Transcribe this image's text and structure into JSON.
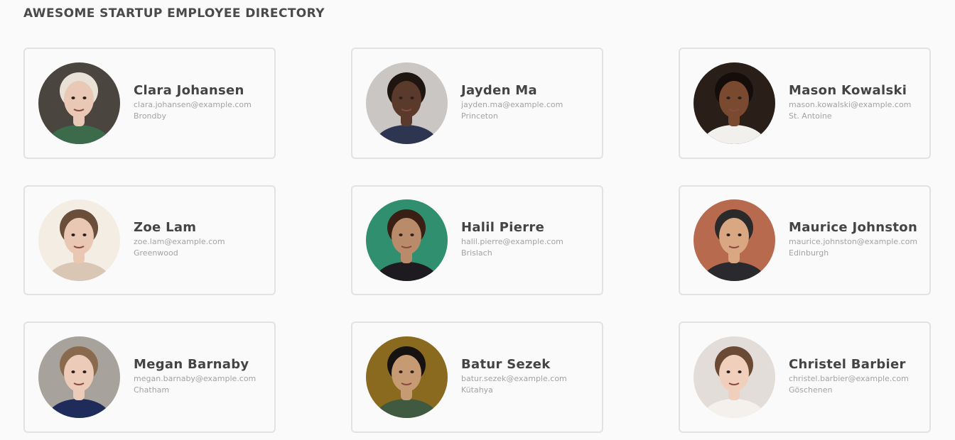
{
  "header": {
    "title": "AWESOME STARTUP EMPLOYEE DIRECTORY"
  },
  "employees": [
    {
      "name": "Clara Johansen",
      "email": "clara.johansen@example.com",
      "city": "Brondby",
      "avatar": {
        "bg": "#4b4540",
        "skin": "#e9c8b6",
        "hair": "#e8e2d6",
        "shirt": "#3b6b4a"
      }
    },
    {
      "name": "Jayden Ma",
      "email": "jayden.ma@example.com",
      "city": "Princeton",
      "avatar": {
        "bg": "#c9c6c4",
        "skin": "#5a3a2a",
        "hair": "#1e1410",
        "shirt": "#2d3550"
      }
    },
    {
      "name": "Mason Kowalski",
      "email": "mason.kowalski@example.com",
      "city": "St. Antoine",
      "avatar": {
        "bg": "#2a1e18",
        "skin": "#7a4a30",
        "hair": "#140d0a",
        "shirt": "#f2f0ec"
      }
    },
    {
      "name": "Zoe Lam",
      "email": "zoe.lam@example.com",
      "city": "Greenwood",
      "avatar": {
        "bg": "#f4ede3",
        "skin": "#eac7b2",
        "hair": "#6a4e3a",
        "shirt": "#d9c6b4"
      }
    },
    {
      "name": "Halil Pierre",
      "email": "halil.pierre@example.com",
      "city": "Brislach",
      "avatar": {
        "bg": "#2f8f6e",
        "skin": "#b98b6a",
        "hair": "#3a1f15",
        "shirt": "#1d1a20"
      }
    },
    {
      "name": "Maurice Johnston",
      "email": "maurice.johnston@example.com",
      "city": "Edinburgh",
      "avatar": {
        "bg": "#b86a4e",
        "skin": "#d9a882",
        "hair": "#2a2a2a",
        "shirt": "#2a2a2e"
      }
    },
    {
      "name": "Megan Barnaby",
      "email": "megan.barnaby@example.com",
      "city": "Chatham",
      "avatar": {
        "bg": "#a7a29c",
        "skin": "#ecccb8",
        "hair": "#8a6a4e",
        "shirt": "#1f2b5a"
      }
    },
    {
      "name": "Batur Sezek",
      "email": "batur.sezek@example.com",
      "city": "Kütahya",
      "avatar": {
        "bg": "#8a6a1e",
        "skin": "#c69a72",
        "hair": "#161210",
        "shirt": "#3f5a40"
      }
    },
    {
      "name": "Christel Barbier",
      "email": "christel.barbier@example.com",
      "city": "Göschenen",
      "avatar": {
        "bg": "#e2ddd8",
        "skin": "#f0d0bc",
        "hair": "#6a4a34",
        "shirt": "#f4f0ec"
      }
    }
  ]
}
